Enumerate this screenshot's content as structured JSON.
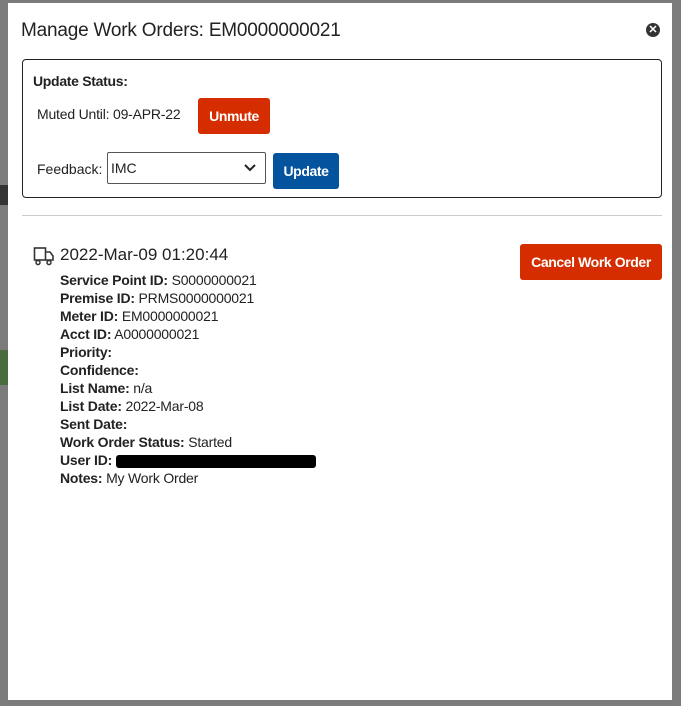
{
  "dialog": {
    "title": "Manage Work Orders: EM0000000021",
    "update_status": {
      "heading": "Update Status:",
      "muted_until": "Muted Until: 09-APR-22",
      "unmute_label": "Unmute",
      "feedback_label": "Feedback:",
      "feedback_value": "IMC",
      "update_label": "Update"
    },
    "work_order": {
      "timestamp": "2022-Mar-09 01:20:44",
      "cancel_label": "Cancel Work Order",
      "fields": [
        {
          "label": "Service Point ID:",
          "value": "S0000000021"
        },
        {
          "label": "Premise ID:",
          "value": "PRMS0000000021"
        },
        {
          "label": "Meter ID:",
          "value": "EM0000000021"
        },
        {
          "label": "Acct ID:",
          "value": "A0000000021"
        },
        {
          "label": "Priority:",
          "value": ""
        },
        {
          "label": "Confidence:",
          "value": ""
        },
        {
          "label": "List Name:",
          "value": "n/a"
        },
        {
          "label": "List Date:",
          "value": "2022-Mar-08"
        },
        {
          "label": "Sent Date:",
          "value": ""
        },
        {
          "label": "Work Order Status:",
          "value": "Started"
        },
        {
          "label": "User ID:",
          "value": ""
        },
        {
          "label": "Notes:",
          "value": "My Work Order"
        }
      ]
    }
  },
  "colors": {
    "danger": "#d62d00",
    "primary": "#04539e"
  }
}
